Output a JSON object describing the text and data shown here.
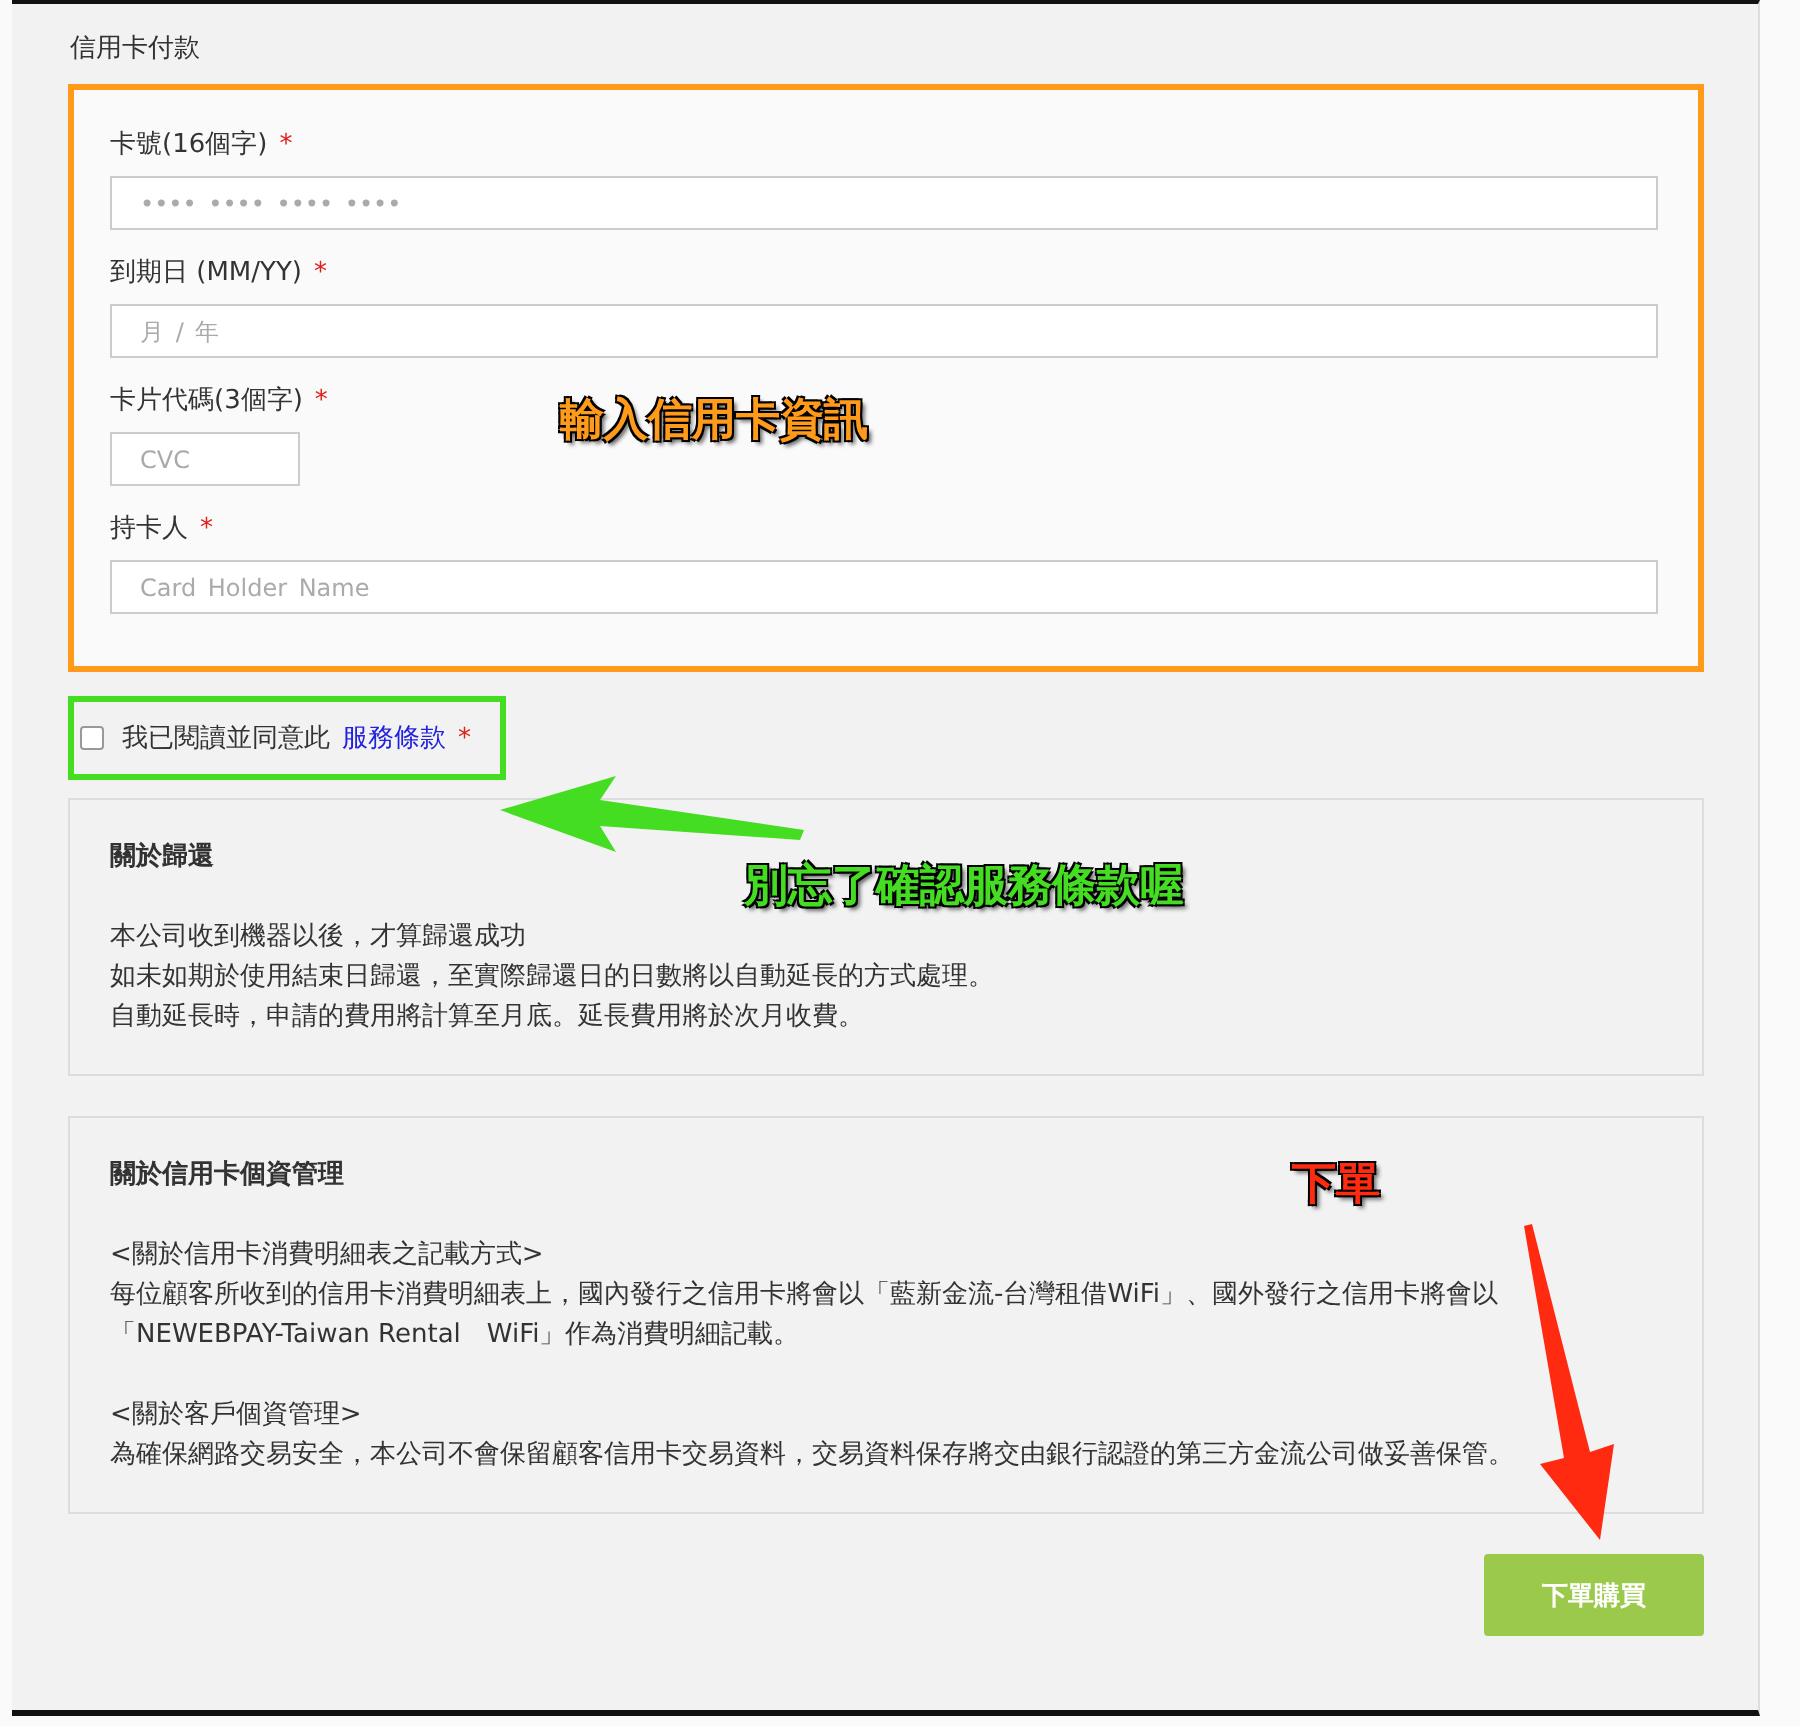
{
  "section_title": "信用卡付款",
  "fields": [
    {
      "label": "卡號(16個字)",
      "required_mark": "*",
      "placeholder": "•••• •••• •••• ••••",
      "kind": "wide"
    },
    {
      "label": "到期日 (MM/YY)",
      "required_mark": "*",
      "placeholder": "月 / 年",
      "kind": "wide"
    },
    {
      "label": "卡片代碼(3個字)",
      "required_mark": "*",
      "placeholder": "CVC",
      "kind": "short"
    },
    {
      "label": "持卡人",
      "required_mark": "*",
      "placeholder": "Card Holder Name",
      "kind": "wide"
    }
  ],
  "agreement": {
    "text": "我已閱讀並同意此",
    "link": "服務條款",
    "required_mark": "*",
    "checked": false
  },
  "info_panels": [
    {
      "title": "關於歸還",
      "paragraphs": [
        [
          "本公司收到機器以後，才算歸還成功",
          "如未如期於使用結束日歸還，至實際歸還日的日數將以自動延長的方式處理。",
          "自動延長時，申請的費用將計算至月底。延長費用將於次月收費。"
        ]
      ]
    },
    {
      "title": "關於信用卡個資管理",
      "paragraphs": [
        [
          "<關於信用卡消費明細表之記載方式>",
          "每位顧客所收到的信用卡消費明細表上，國內發行之信用卡將會以「藍新金流-台灣租借WiFi」、國外發行之信用卡將會以",
          "「NEWEBPAY-Taiwan Rental　WiFi」作為消費明細記載。"
        ],
        [
          "<關於客戶個資管理>",
          "為確保網路交易安全，本公司不會保留顧客信用卡交易資料，交易資料保存將交由銀行認證的第三方金流公司做妥善保管。"
        ]
      ]
    }
  ],
  "submit": "下單購買",
  "annotations": [
    {
      "text": "輸入信用卡資訊",
      "color": "#ff9a1a"
    },
    {
      "text": "別忘了確認服務條款喔",
      "color": "#44dd22"
    },
    {
      "text": "下單",
      "color": "#ff2a10"
    }
  ]
}
